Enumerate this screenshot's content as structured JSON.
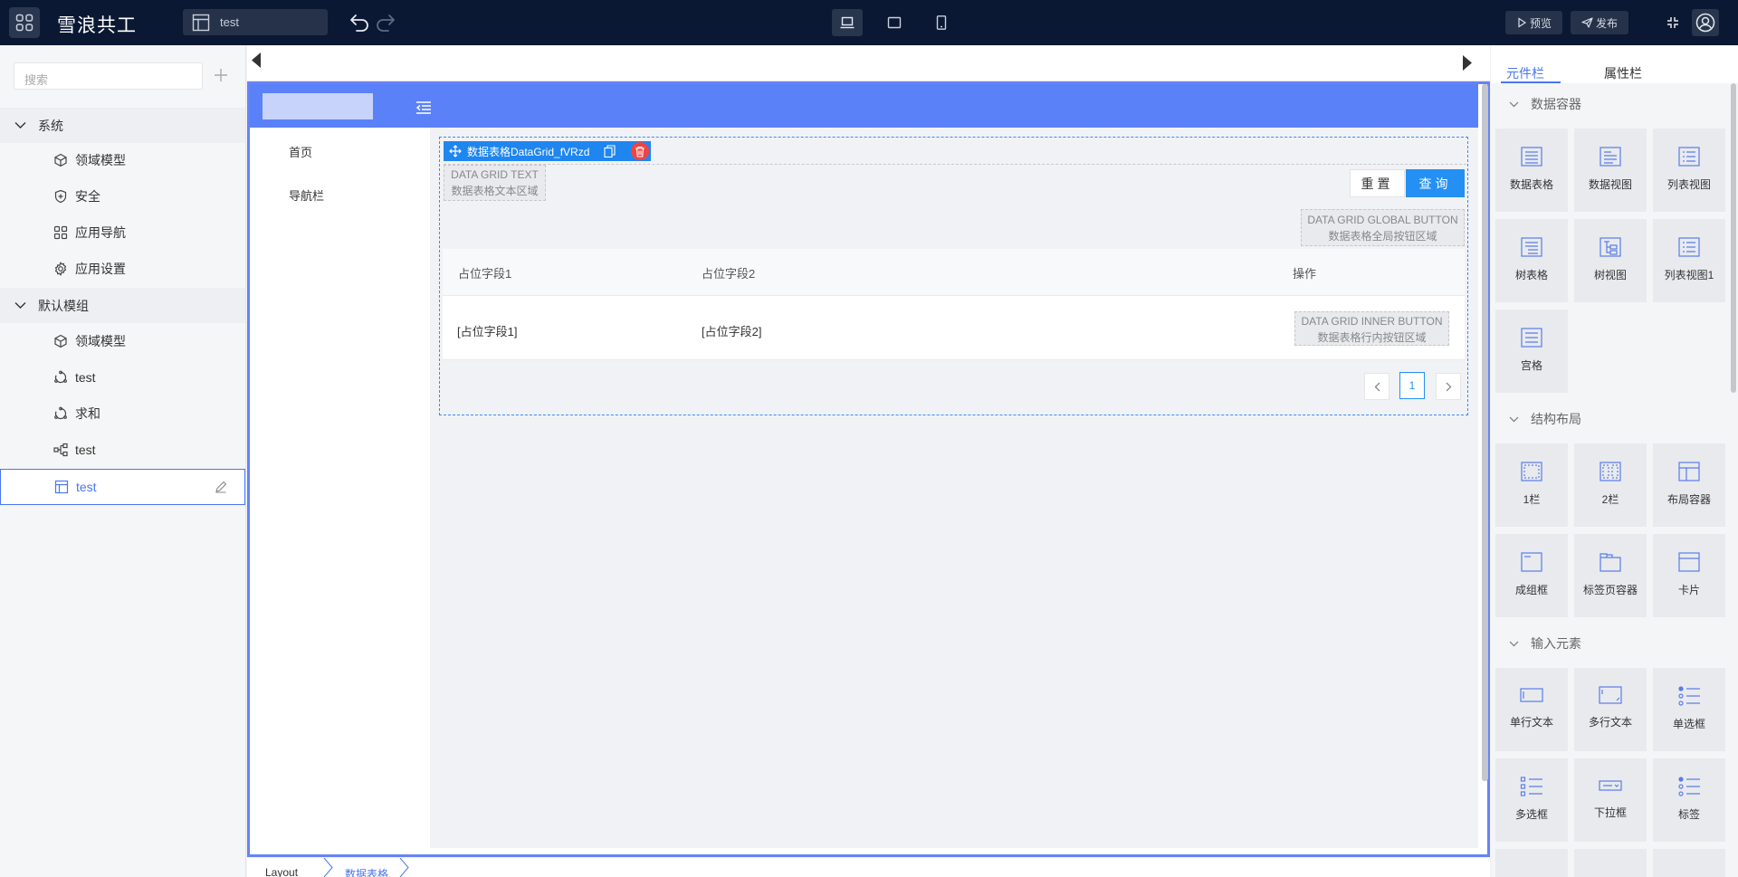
{
  "topbar": {
    "app_name": "雪浪共工",
    "page_name": "test",
    "preview_label": "预览",
    "publish_label": "发布"
  },
  "sidebar": {
    "search_placeholder": "搜索",
    "groups": [
      {
        "label": "系统",
        "items": [
          "领域模型",
          "安全",
          "应用导航",
          "应用设置"
        ]
      },
      {
        "label": "默认模组",
        "items": [
          "领域模型",
          "test",
          "求和",
          "test",
          "test"
        ]
      }
    ]
  },
  "canvas": {
    "nav": [
      "首页",
      "导航栏"
    ],
    "datagrid": {
      "toolbar_label": "数据表格DataGrid_fVRzd",
      "text_slot": [
        "DATA GRID TEXT",
        "数据表格文本区域"
      ],
      "reset_label": "重置",
      "query_label": "查询",
      "global_slot": [
        "DATA GRID GLOBAL BUTTON",
        "数据表格全局按钮区域"
      ],
      "columns": [
        "占位字段1",
        "占位字段2",
        "操作"
      ],
      "row": [
        "[占位字段1]",
        "[占位字段2]"
      ],
      "inner_slot": [
        "DATA GRID INNER BUTTON",
        "数据表格行内按钮区域"
      ],
      "page": "1"
    }
  },
  "breadcrumb": [
    "Layout",
    "数据表格"
  ],
  "right_panel": {
    "tabs": [
      "元件栏",
      "属性栏"
    ],
    "sections": [
      {
        "title": "数据容器",
        "items": [
          "数据表格",
          "数据视图",
          "列表视图",
          "树表格",
          "树视图",
          "列表视图1",
          "宫格"
        ]
      },
      {
        "title": "结构布局",
        "items": [
          "1栏",
          "2栏",
          "布局容器",
          "成组框",
          "标签页容器",
          "卡片"
        ]
      },
      {
        "title": "输入元素",
        "items": [
          "单行文本",
          "多行文本",
          "单选框",
          "多选框",
          "下拉框",
          "标签"
        ]
      }
    ]
  },
  "colors": {
    "accent": "#4a77f1",
    "topbar": "#0b1833",
    "canvas_header": "#5b81f8",
    "primary_button": "#2590f3",
    "delete": "#f14343"
  }
}
